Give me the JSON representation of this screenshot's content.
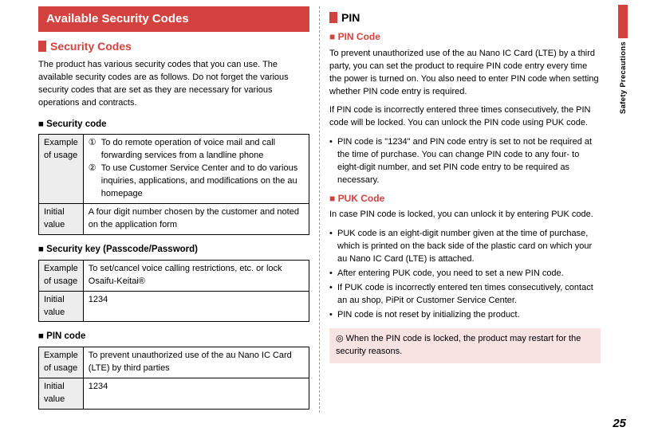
{
  "sideTab": {
    "label": "Safety Precautions"
  },
  "pageNumber": "25",
  "left": {
    "banner": "Available Security Codes",
    "subheading": "Security Codes",
    "intro": "The product has various security codes that you can use.\nThe available security codes are as follows. Do not forget the various security codes that are set as they are necessary for various operations and contracts.",
    "tables": {
      "securityCode": {
        "heading": "Security code",
        "exampleLabel": "Example of usage",
        "example1_num": "①",
        "example1": "To do remote operation of voice mail and call forwarding services from a landline phone",
        "example2_num": "②",
        "example2": "To use Customer Service Center and to do various inquiries, applications, and modifications on the au homepage",
        "initialLabel": "Initial value",
        "initial": "A four digit number chosen by the customer and noted on the application form"
      },
      "securityKey": {
        "heading": "Security key (Passcode/Password)",
        "exampleLabel": "Example of usage",
        "example": "To set/cancel voice calling restrictions, etc. or lock Osaifu-Keitai®",
        "initialLabel": "Initial value",
        "initial": "1234"
      },
      "pinCode": {
        "heading": "PIN code",
        "exampleLabel": "Example of usage",
        "example": "To prevent unauthorized use of the au Nano IC Card (LTE) by third parties",
        "initialLabel": "Initial value",
        "initial": "1234"
      }
    }
  },
  "right": {
    "heading": "PIN",
    "pinCode": {
      "heading": "PIN Code",
      "para1": "To prevent unauthorized use of the au Nano IC Card (LTE) by a third party, you can set the product to require PIN code entry every time the power is turned on. You also need to enter PIN code when setting whether PIN code entry is required.",
      "para2": "If PIN code is incorrectly entered three times consecutively, the PIN code will be locked. You can unlock the PIN code using PUK code.",
      "bullet1": "PIN code is \"1234\" and PIN code entry is set to not be required at the time of purchase. You can change PIN code to any four- to eight-digit number, and set PIN code entry to be required as necessary."
    },
    "pukCode": {
      "heading": "PUK Code",
      "intro": "In case PIN code is locked, you can unlock it by entering PUK code.",
      "b1": "PUK code is an eight-digit number given at the time of purchase, which is printed on the back side of the plastic card on which your au Nano IC Card (LTE) is attached.",
      "b2": "After entering PUK code, you need to set a new PIN code.",
      "b3": "If PUK code is incorrectly entered ten times consecutively, contact an au shop, PiPit or Customer Service Center.",
      "b4": "PIN code is not reset by initializing the product."
    },
    "note": "◎ When the PIN code is locked, the product may restart for the security reasons."
  }
}
